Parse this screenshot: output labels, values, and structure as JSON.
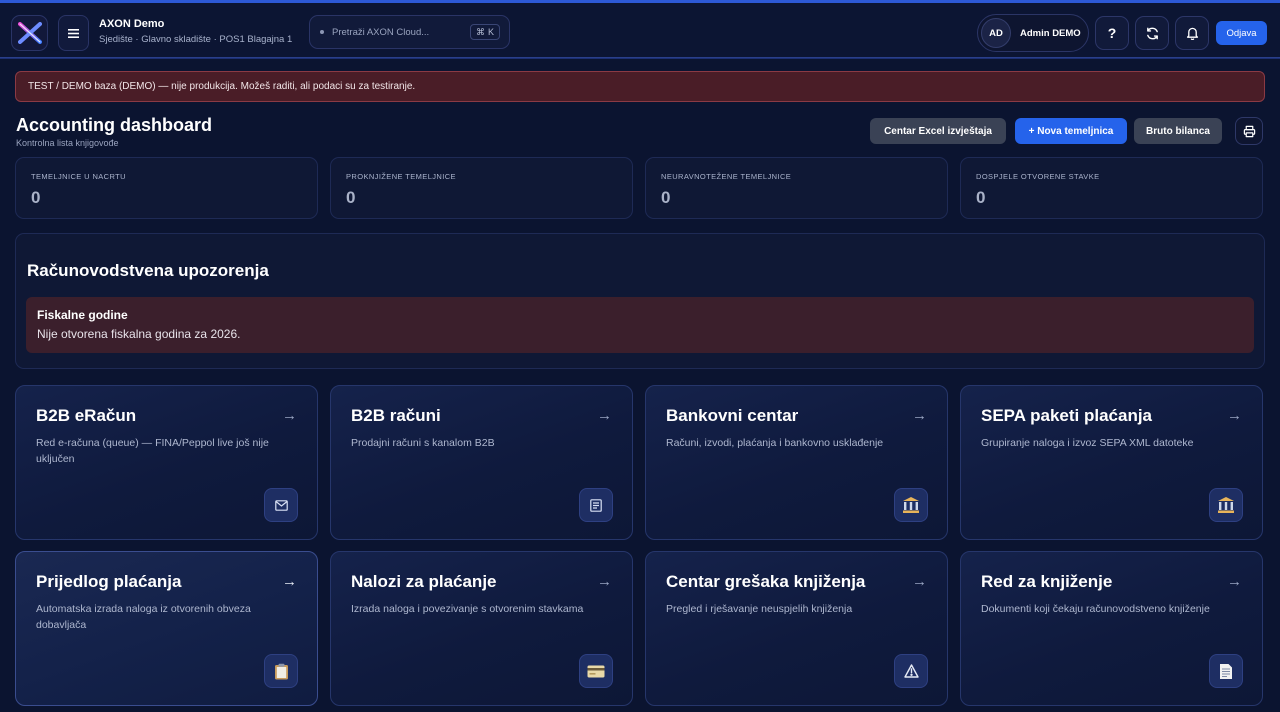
{
  "header": {
    "app_title": "AXON Demo",
    "location": "Sjedište · Glavno skladište · POS1 Blagajna 1",
    "search_placeholder": "Pretraži AXON Cloud...",
    "search_shortcut_symbol": "⌘",
    "search_shortcut_key": "K",
    "user_initials": "AD",
    "user_name": "Admin DEMO",
    "help_label": "?",
    "logout_label": "Odjava"
  },
  "banner": {
    "text": "TEST / DEMO baza (DEMO) — nije produkcija. Možeš raditi, ali podaci su za testiranje."
  },
  "page": {
    "title": "Accounting dashboard",
    "subtitle": "Kontrolna lista knjigovođe"
  },
  "actions": {
    "excel_center": "Centar Excel izvještaja",
    "new_journal": "+ Nova temeljnica",
    "trial_balance": "Bruto bilanca"
  },
  "stats": [
    {
      "label": "Temeljnice u nacrtu",
      "value": "0"
    },
    {
      "label": "Proknjižene temeljnice",
      "value": "0"
    },
    {
      "label": "Neuravnotežene temeljnice",
      "value": "0"
    },
    {
      "label": "Dospjele otvorene stavke",
      "value": "0"
    }
  ],
  "warnings": {
    "title": "Računovodstvena upozorenja",
    "item_title": "Fiskalne godine",
    "item_text": "Nije otvorena fiskalna godina za 2026."
  },
  "cards": [
    {
      "title": "B2B eRačun",
      "desc": "Red e-računa (queue) — FINA/Peppol live još nije uključen",
      "icon": "mail-icon"
    },
    {
      "title": "B2B računi",
      "desc": "Prodajni računi s kanalom B2B",
      "icon": "receipt-icon"
    },
    {
      "title": "Bankovni centar",
      "desc": "Računi, izvodi, plaćanja i bankovno usklađenje",
      "icon": "bank-icon"
    },
    {
      "title": "SEPA paketi plaćanja",
      "desc": "Grupiranje naloga i izvoz SEPA XML datoteke",
      "icon": "bank-icon"
    },
    {
      "title": "Prijedlog plaćanja",
      "desc": "Automatska izrada naloga iz otvorenih obveza dobavljača",
      "icon": "clipboard-icon"
    },
    {
      "title": "Nalozi za plaćanje",
      "desc": "Izrada naloga i povezivanje s otvorenim stavkama",
      "icon": "credit-card-icon"
    },
    {
      "title": "Centar grešaka knjiženja",
      "desc": "Pregled i rješavanje neuspjelih knjiženja",
      "icon": "warning-icon"
    },
    {
      "title": "Red za knjiženje",
      "desc": "Dokumenti koji čekaju računovodstveno knjiženje",
      "icon": "document-icon"
    }
  ],
  "colors": {
    "accent": "#2563eb",
    "background": "#0b1430",
    "warning_bg": "#3b1f2c",
    "banner_bg": "#4a1d27"
  }
}
